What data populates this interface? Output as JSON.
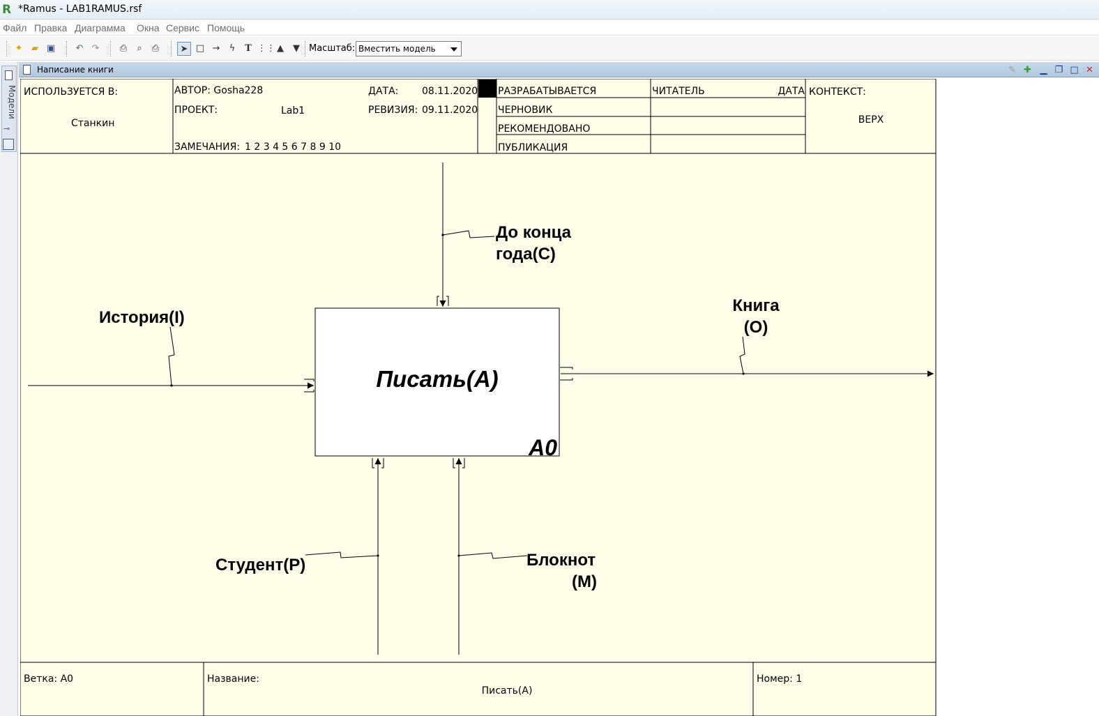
{
  "window": {
    "title": "*Ramus - LAB1RAMUS.rsf",
    "icon": "ramus-logo-icon"
  },
  "menu": [
    "Файл",
    "Правка",
    "Диаграмма",
    "Окна",
    "Сервис",
    "Помощь"
  ],
  "toolbar": {
    "buttons": [
      "new-icon",
      "open-folder-icon",
      "save-icon",
      "undo-icon",
      "redo-icon",
      "print-icon",
      "print-preview-icon",
      "printer-icon",
      "pointer-tool-icon",
      "rectangle-tool-icon",
      "arrow-tool-icon",
      "lightning-tool-icon",
      "text-tool-icon",
      "grid-tool-icon",
      "move-up-icon",
      "move-down-icon"
    ],
    "scale_label": "Масштаб:",
    "scale_value": "Вместить модель"
  },
  "side_panel": {
    "tab_label": "Модели"
  },
  "document_tab": {
    "title": "Написание книги"
  },
  "header": {
    "used_in_label": "ИСПОЛЬЗУЕТСЯ В:",
    "used_in_value": "Станкин",
    "author_label": "АВТОР: Gosha228",
    "project_label": "ПРОЕКТ:",
    "project_value": "Lab1",
    "notes_label": "ЗАМЕЧАНИЯ:",
    "notes_value": "1 2 3 4 5 6 7 8 9 10",
    "date_label": "ДАТА:",
    "date_value": "08.11.2020",
    "revision_label": "РЕВИЗИЯ:",
    "revision_value": "09.11.2020",
    "status": [
      "РАЗРАБАТЫВАЕТСЯ",
      "ЧЕРНОВИК",
      "РЕКОМЕНДОВАНО",
      "ПУБЛИКАЦИЯ"
    ],
    "reader_label": "ЧИТАТЕЛЬ",
    "reader_date_label": "ДАТА",
    "context_label": "КОНТЕКСТ:",
    "context_value": "ВЕРХ"
  },
  "diagram": {
    "function_name": "Писать(A)",
    "function_number": "A0",
    "control_label_1": "До конца",
    "control_label_2": "года(C)",
    "input_label": "История(I)",
    "output_label_1": "Книга",
    "output_label_2": "(O)",
    "mechanism1_label": "Студент(P)",
    "mechanism2_label_1": "Блокнот",
    "mechanism2_label_2": "(M)"
  },
  "footer": {
    "branch_label": "Ветка: A0",
    "name_label": "Название:",
    "name_value": "Писать(A)",
    "number_label": "Номер: 1"
  },
  "colors": {
    "diagram_background": "#fdfde8",
    "panel_header": "#b8cce2"
  }
}
